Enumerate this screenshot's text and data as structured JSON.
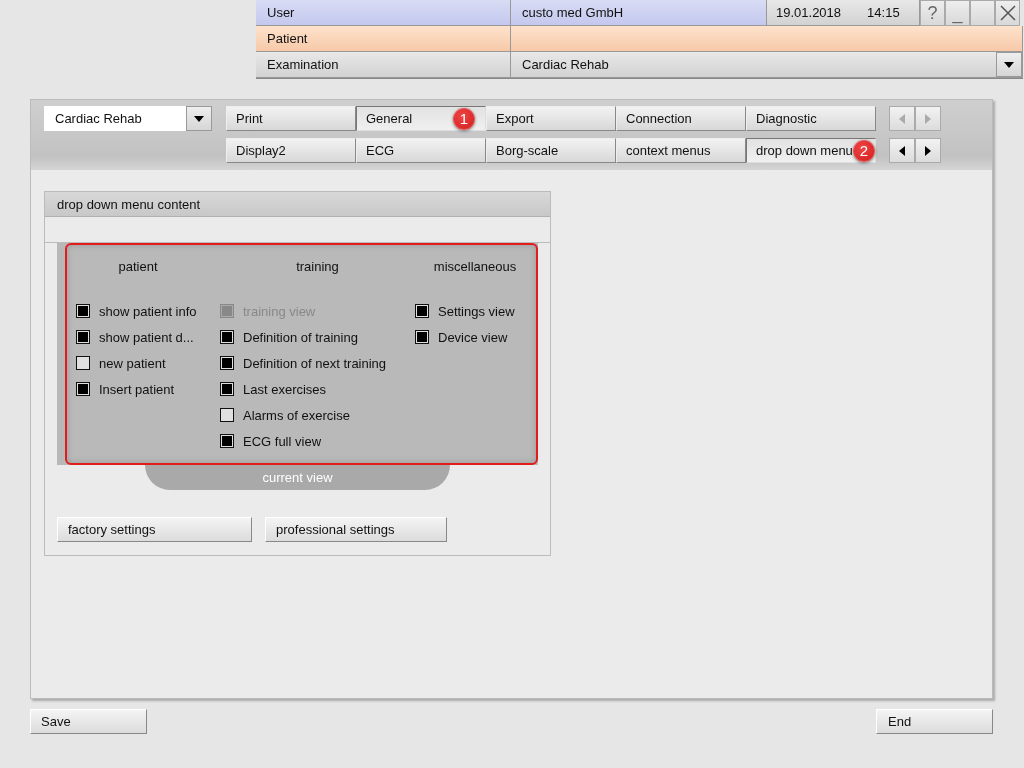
{
  "header": {
    "user_label": "User",
    "user_value": "custo med GmbH",
    "date": "19.01.2018",
    "time": "14:15",
    "help": "?",
    "minimize": "_",
    "patient_label": "Patient",
    "examination_label": "Examination",
    "examination_value": "Cardiac Rehab"
  },
  "profile_dropdown": {
    "value": "Cardiac Rehab"
  },
  "tab_rows": [
    {
      "nav_disabled": true,
      "tabs": [
        {
          "label": "Print",
          "selected": false
        },
        {
          "label": "General",
          "selected": true,
          "badge": "1"
        },
        {
          "label": "Export",
          "selected": false
        },
        {
          "label": "Connection",
          "selected": false
        },
        {
          "label": "Diagnostic",
          "selected": false
        }
      ]
    },
    {
      "nav_disabled": false,
      "tabs": [
        {
          "label": "Display2",
          "selected": false
        },
        {
          "label": "ECG",
          "selected": false
        },
        {
          "label": "Borg-scale",
          "selected": false
        },
        {
          "label": "context menus",
          "selected": false
        },
        {
          "label": "drop down menu",
          "selected": true,
          "badge": "2"
        }
      ]
    }
  ],
  "panel": {
    "title": "drop down menu content",
    "groups": [
      {
        "heading": "patient",
        "items": [
          {
            "label": "show patient info",
            "checked": true,
            "disabled": false
          },
          {
            "label": "show patient d...",
            "checked": true,
            "disabled": false
          },
          {
            "label": "new patient",
            "checked": false,
            "disabled": false
          },
          {
            "label": "Insert patient",
            "checked": true,
            "disabled": false
          }
        ]
      },
      {
        "heading": "training",
        "items": [
          {
            "label": "training view",
            "checked": true,
            "disabled": true
          },
          {
            "label": "Definition of training",
            "checked": true,
            "disabled": false
          },
          {
            "label": "Definition of next training",
            "checked": true,
            "disabled": false
          },
          {
            "label": "Last exercises",
            "checked": true,
            "disabled": false
          },
          {
            "label": "Alarms of exercise",
            "checked": false,
            "disabled": false
          },
          {
            "label": "ECG full view",
            "checked": true,
            "disabled": false
          }
        ]
      },
      {
        "heading": "miscellaneous",
        "items": [
          {
            "label": "Settings view",
            "checked": true,
            "disabled": false
          },
          {
            "label": "Device view",
            "checked": true,
            "disabled": false
          }
        ]
      }
    ],
    "view_label": "current view",
    "buttons": [
      "factory settings",
      "professional settings"
    ]
  },
  "footer": {
    "buttons": [
      "Save",
      "End"
    ]
  }
}
